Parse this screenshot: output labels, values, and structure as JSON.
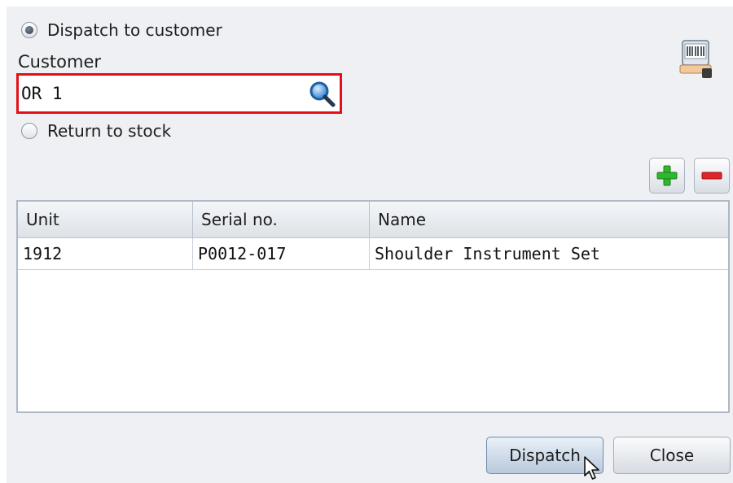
{
  "dispatch_option": {
    "label": "Dispatch to customer",
    "selected": true
  },
  "customer": {
    "label": "Customer",
    "value": "OR 1",
    "search_icon": "magnifier-icon"
  },
  "return_option": {
    "label": "Return to stock",
    "selected": false
  },
  "icons": {
    "scanner": "barcode-scanner-icon",
    "add": "plus-icon",
    "remove": "minus-icon"
  },
  "table": {
    "columns": [
      "Unit",
      "Serial no.",
      "Name"
    ],
    "rows": [
      [
        "1912",
        "P0012-017",
        "Shoulder Instrument Set"
      ]
    ]
  },
  "buttons": {
    "dispatch": "Dispatch",
    "close": "Close"
  },
  "colors": {
    "highlight": "#e3101a",
    "add": "#2fb82f",
    "remove": "#e0242a"
  }
}
